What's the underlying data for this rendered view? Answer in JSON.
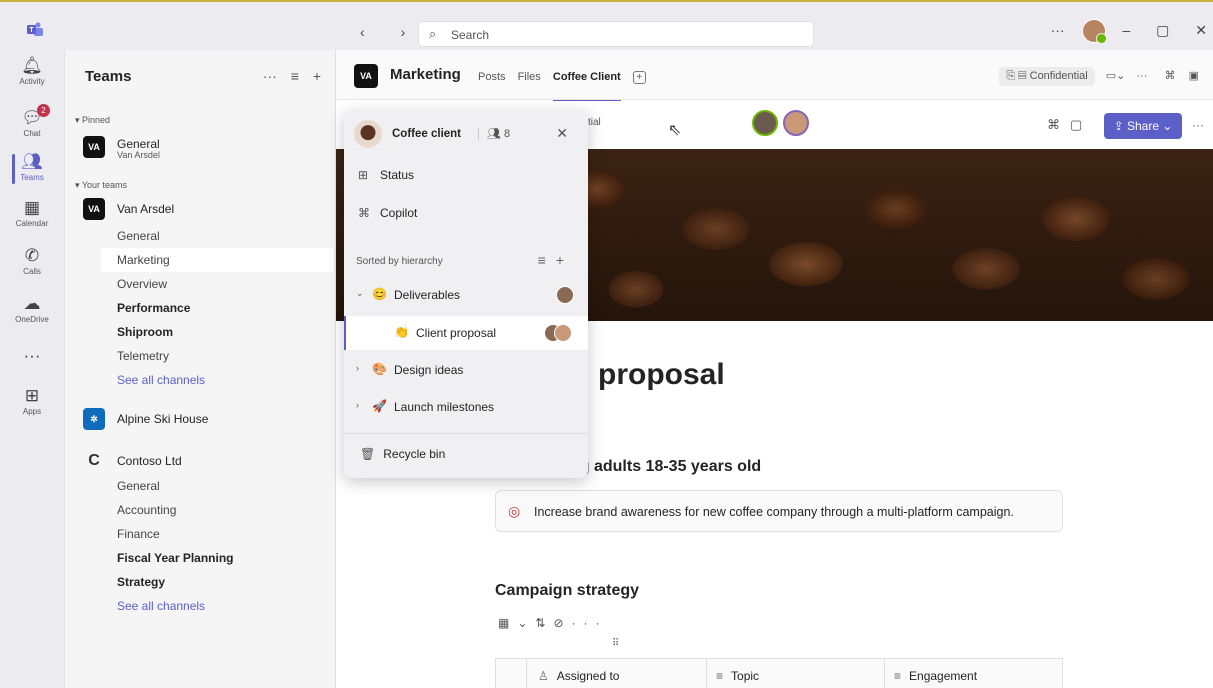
{
  "top_bar": {
    "search_placeholder": "Search",
    "back": "‹",
    "forward": "›",
    "more": "···",
    "minimize": "–",
    "maximize": "▢",
    "close": "✕"
  },
  "rail": {
    "items": [
      {
        "label": "Activity",
        "icon": "bell-icon"
      },
      {
        "label": "Chat",
        "icon": "chat-icon",
        "badge": "2"
      },
      {
        "label": "Teams",
        "icon": "teams-icon"
      },
      {
        "label": "Calendar",
        "icon": "calendar-icon"
      },
      {
        "label": "Calls",
        "icon": "phone-icon"
      },
      {
        "label": "OneDrive",
        "icon": "cloud-icon"
      },
      {
        "label": "···",
        "icon": "more-icon"
      },
      {
        "label": "Apps",
        "icon": "apps-icon"
      }
    ]
  },
  "teams_panel": {
    "title": "Teams",
    "pinned_label": "▾ Pinned",
    "your_teams_label": "▾ Your teams",
    "pinned": {
      "name": "General",
      "sub": "Van Arsdel",
      "logo": "VA"
    },
    "team1": {
      "name": "Van Arsdel",
      "logo": "VA",
      "channels": [
        "General",
        "Marketing",
        "Overview",
        "Performance",
        "Shiproom",
        "Telemetry",
        "See all channels"
      ]
    },
    "team2": {
      "name": "Alpine Ski House",
      "logo": "✲"
    },
    "team3": {
      "name": "Contoso Ltd",
      "logo": "C",
      "channels": [
        "General",
        "Accounting",
        "Finance",
        "Fiscal Year Planning",
        "Strategy",
        "See all channels"
      ]
    }
  },
  "channel_header": {
    "logo": "VA",
    "title": "Marketing",
    "tabs": [
      "Posts",
      "Files",
      "Coffee Client"
    ],
    "confidential": "Confidential",
    "share": "Share ⌄"
  },
  "popup": {
    "workspace": "Coffee client",
    "member_count": "8",
    "status": "Status",
    "copilot": "Copilot",
    "sorted_label": "Sorted by hierarchy",
    "nodes": [
      {
        "label": "Deliverables",
        "emoji": "😊"
      },
      {
        "label": "Client proposal",
        "emoji": "👏"
      },
      {
        "label": "Design ideas",
        "emoji": "🎨"
      },
      {
        "label": "Launch milestones",
        "emoji": "🚀"
      }
    ],
    "recycle": "Recycle bin",
    "behind_text": "tial"
  },
  "document": {
    "title": "proposal",
    "audience": "ence: Young adults 18-35 years old",
    "goal": "Increase brand awareness for new coffee company through a multi-platform campaign.",
    "strategy_heading": "Campaign strategy",
    "table_headers": [
      "Assigned to",
      "Topic",
      "Engagement"
    ]
  },
  "colors": {
    "accent": "#5b5fc7",
    "badge": "#c4314b",
    "presence": "#6bb700"
  }
}
